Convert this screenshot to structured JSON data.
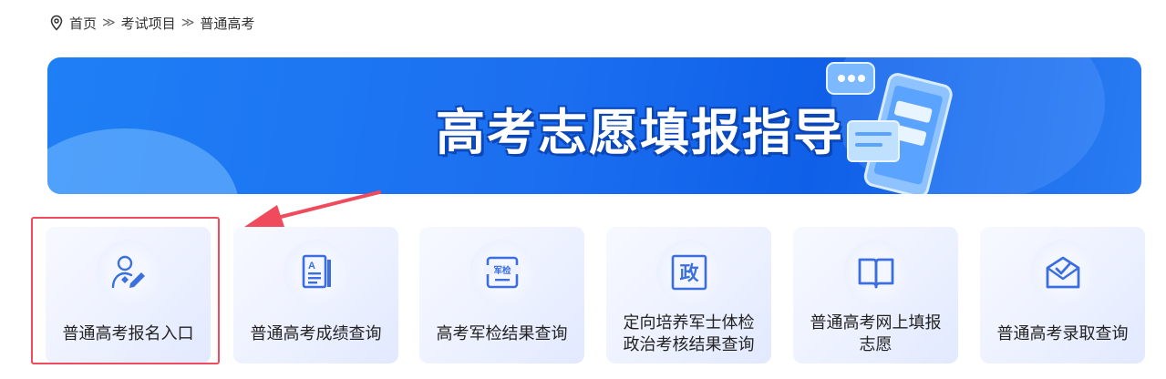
{
  "breadcrumb": {
    "items": [
      "首页",
      "考试项目",
      "普通高考"
    ],
    "separator": "≫"
  },
  "banner": {
    "title": "高考志愿填报指导"
  },
  "cards": [
    {
      "label": "普通高考报名入口",
      "icon": "user-pen-icon"
    },
    {
      "label": "普通高考成绩查询",
      "icon": "document-a-icon"
    },
    {
      "label": "高考军检结果查询",
      "icon": "military-check-icon",
      "icon_text": "军检"
    },
    {
      "label": "定向培养军士体检政治考核结果查询",
      "icon": "politics-icon",
      "icon_text": "政"
    },
    {
      "label": "普通高考网上填报志愿",
      "icon": "open-book-icon"
    },
    {
      "label": "普通高考录取查询",
      "icon": "envelope-check-icon"
    }
  ],
  "colors": {
    "accent": "#3b6fe0",
    "highlight": "#ef4b5c",
    "banner": "#1b6ff0"
  }
}
